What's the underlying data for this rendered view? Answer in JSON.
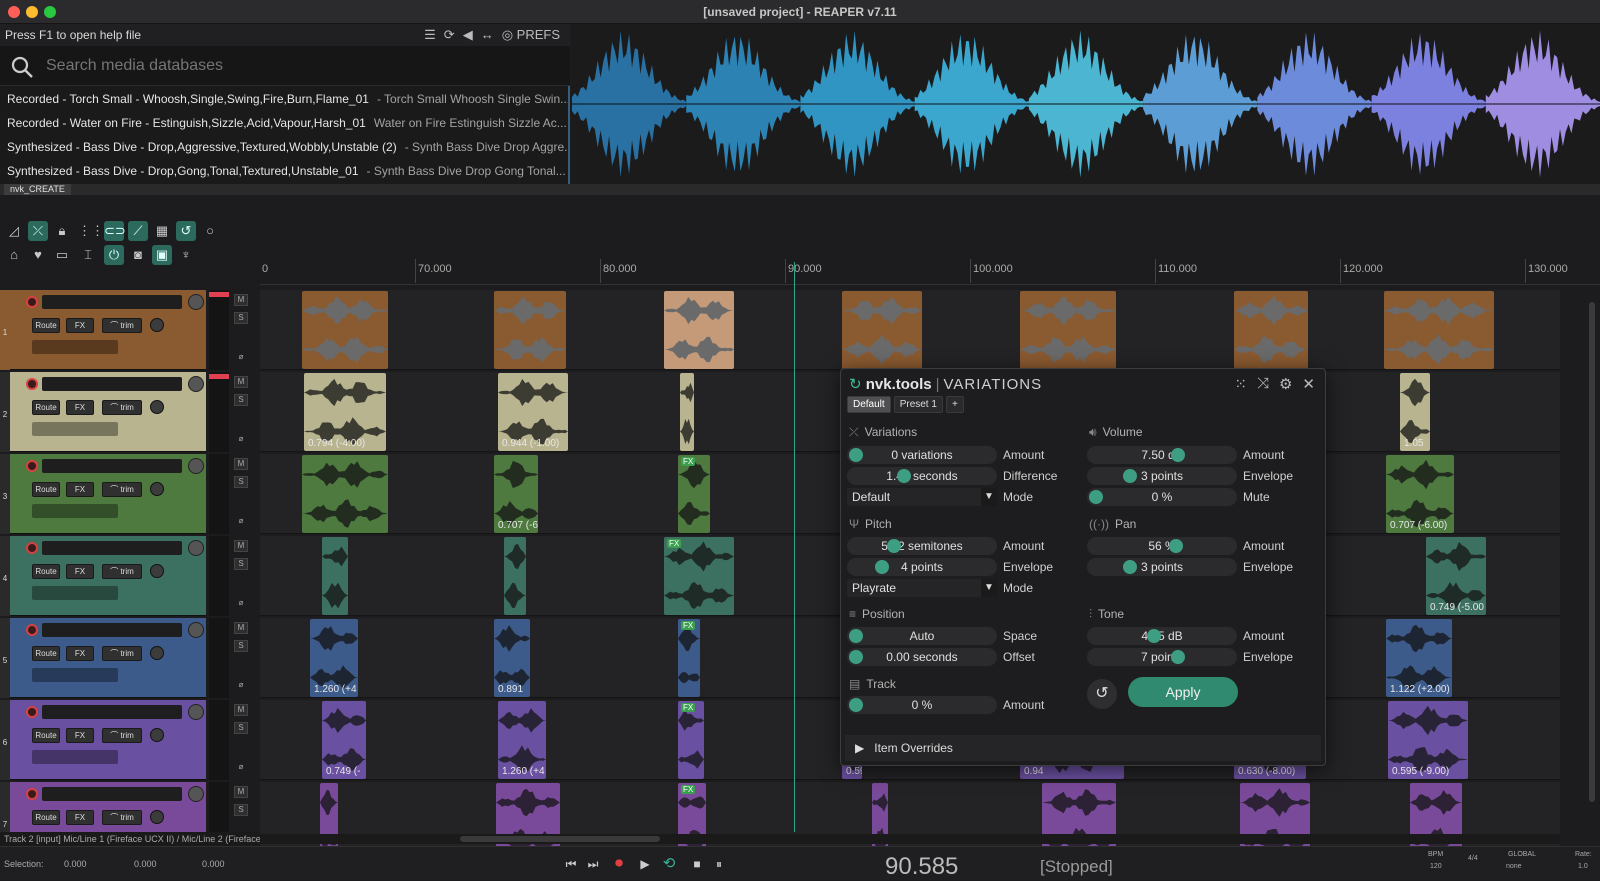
{
  "window": {
    "title": "[unsaved project] - REAPER v7.11"
  },
  "explorer": {
    "help_text": "Press F1 to open help file",
    "prefs_label": "PREFS",
    "search_placeholder": "Search media databases",
    "results": [
      {
        "name": "Recorded - Torch Small - Whoosh,Single,Swing,Fire,Burn,Flame_01",
        "desc": "-  Torch Small Whoosh Single Swin..."
      },
      {
        "name": "Recorded - Water on Fire - Estinguish,Sizzle,Acid,Vapour,Harsh_01",
        "desc": "Water on Fire Estinguish Sizzle Ac..."
      },
      {
        "name": "Synthesized - Bass Dive - Drop,Aggressive,Textured,Wobbly,Unstable (2)",
        "desc": "-  Synth Bass Dive Drop Aggre..."
      },
      {
        "name": "Synthesized - Bass Dive - Drop,Gong,Tonal,Textured,Unstable_01",
        "desc": "-  Synth Bass Dive Drop Gong Tonal..."
      }
    ]
  },
  "dock_tab": "nvk_CREATE",
  "ruler": [
    "0",
    "70.000",
    "80.000",
    "90.000",
    "100.000",
    "110.000",
    "120.000",
    "130.000"
  ],
  "tracks": [
    {
      "num": "1",
      "color": "#8a5a30",
      "labels": []
    },
    {
      "num": "2",
      "color": "#b8b490",
      "labels": [
        "0.794 (-4.00)",
        "0.944 (-1.00)",
        "1.05"
      ]
    },
    {
      "num": "3",
      "color": "#4e7a40",
      "labels": [
        "0.707 (-6",
        "0.707 (-6.00)"
      ]
    },
    {
      "num": "4",
      "color": "#3c7060",
      "labels": [
        "0.749 (-5.00"
      ]
    },
    {
      "num": "5",
      "color": "#3c5a8a",
      "labels": [
        "1.260 (+4",
        "0.891",
        "1.122 (+2.00)"
      ]
    },
    {
      "num": "6",
      "color": "#6a50a0",
      "labels": [
        "0.749 (-",
        "1.260 (+4",
        "0.595",
        "0.630 (-8.00)",
        "0.94",
        "0.595 (-9.00)"
      ]
    },
    {
      "num": "7",
      "color": "#7a4a9a",
      "labels": []
    }
  ],
  "track_buttons": {
    "route": "Route",
    "fx": "FX",
    "trim": "trim",
    "mute": "M",
    "solo": "S"
  },
  "status_line": "Track 2 [input] Mic/Line 1 (Fireface UCX II) / Mic/Line 2 (Fireface",
  "transport": {
    "selection_label": "Selection:",
    "sel_values": [
      "0.000",
      "0.000",
      "0.000"
    ],
    "time": "90.585",
    "state": "[Stopped]",
    "bpm_label": "BPM",
    "bpm": "120",
    "sig": "4/4",
    "global_label": "GLOBAL",
    "none_label": "none",
    "rate_label": "Rate:",
    "rate": "1.0"
  },
  "plugin": {
    "brand": "nvk.tools",
    "separator": "|",
    "name": "VARIATIONS",
    "tabs": [
      "Default",
      "Preset 1",
      "+"
    ],
    "variations": {
      "header": "Variations",
      "amount_value": "0 variations",
      "amount_label": "Amount",
      "diff_value": "1.40 seconds",
      "diff_label": "Difference",
      "mode_value": "Default",
      "mode_label": "Mode"
    },
    "pitch": {
      "header": "Pitch",
      "amount_value": "5.02 semitones",
      "amount_label": "Amount",
      "env_value": "4 points",
      "env_label": "Envelope",
      "mode_value": "Playrate",
      "mode_label": "Mode"
    },
    "position": {
      "header": "Position",
      "space_value": "Auto",
      "space_label": "Space",
      "offset_value": "0.00 seconds",
      "offset_label": "Offset"
    },
    "track": {
      "header": "Track",
      "amount_value": "0 %",
      "amount_label": "Amount"
    },
    "volume": {
      "header": "Volume",
      "amount_value": "7.50 dB",
      "amount_label": "Amount",
      "env_value": "3 points",
      "env_label": "Envelope",
      "mute_value": "0 %",
      "mute_label": "Mute"
    },
    "pan": {
      "header": "Pan",
      "amount_value": "56 %",
      "amount_label": "Amount",
      "env_value": "3 points",
      "env_label": "Envelope"
    },
    "tone": {
      "header": "Tone",
      "amount_value": "4.95 dB",
      "amount_label": "Amount",
      "env_value": "7 points",
      "env_label": "Envelope"
    },
    "apply_label": "Apply",
    "overrides_label": "Item Overrides"
  }
}
